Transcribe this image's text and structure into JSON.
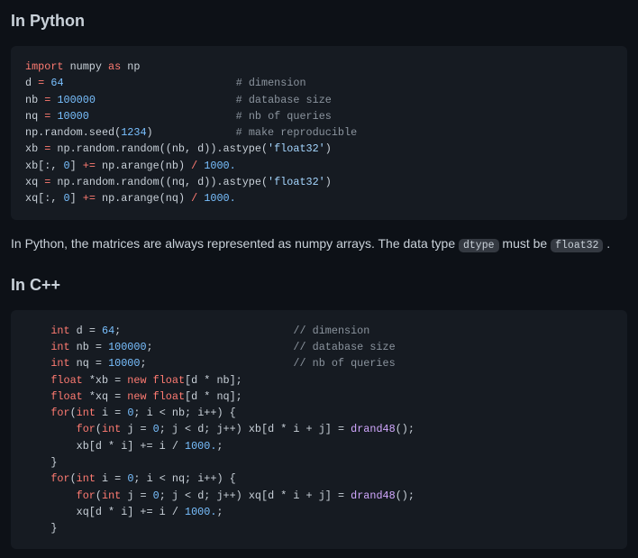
{
  "h_py": "In Python",
  "h_cpp": "In C++",
  "para": {
    "pre": "In Python, the matrices are always represented as numpy arrays. The data type ",
    "code1": "dtype",
    "mid": " must be ",
    "code2": "float32",
    "post": " ."
  },
  "py": {
    "l1_a": "import",
    "l1_b": " numpy ",
    "l1_c": "as",
    "l1_d": " np",
    "l2_a": "d ",
    "l2_b": "=",
    "l2_c": " ",
    "l2_d": "64",
    "l2_e": "                           ",
    "l2_f": "# dimension",
    "l3_a": "nb ",
    "l3_b": "=",
    "l3_c": " ",
    "l3_d": "100000",
    "l3_e": "                      ",
    "l3_f": "# database size",
    "l4_a": "nq ",
    "l4_b": "=",
    "l4_c": " ",
    "l4_d": "10000",
    "l4_e": "                       ",
    "l4_f": "# nb of queries",
    "l5_a": "np.random.seed(",
    "l5_b": "1234",
    "l5_c": ")             ",
    "l5_d": "# make reproducible",
    "l6_a": "xb ",
    "l6_b": "=",
    "l6_c": " np.random.random((nb, d)).astype(",
    "l6_d": "'float32'",
    "l6_e": ")",
    "l7_a": "xb[:, ",
    "l7_b": "0",
    "l7_c": "] ",
    "l7_d": "+=",
    "l7_e": " np.arange(nb) ",
    "l7_f": "/",
    "l7_g": " ",
    "l7_h": "1000.",
    "l8_a": "xq ",
    "l8_b": "=",
    "l8_c": " np.random.random((nq, d)).astype(",
    "l8_d": "'float32'",
    "l8_e": ")",
    "l9_a": "xq[:, ",
    "l9_b": "0",
    "l9_c": "] ",
    "l9_d": "+=",
    "l9_e": " np.arange(nq) ",
    "l9_f": "/",
    "l9_g": " ",
    "l9_h": "1000."
  },
  "cpp": {
    "pad": "    ",
    "pad2": "        ",
    "l1_a": "int",
    "l1_b": " d = ",
    "l1_c": "64",
    "l1_d": ";                           ",
    "l1_e": "// dimension",
    "l2_a": "int",
    "l2_b": " nb = ",
    "l2_c": "100000",
    "l2_d": ";                      ",
    "l2_e": "// database size",
    "l3_a": "int",
    "l3_b": " nq = ",
    "l3_c": "10000",
    "l3_d": ";                       ",
    "l3_e": "// nb of queries",
    "l4_a": "float",
    "l4_b": " *xb = ",
    "l4_c": "new",
    "l4_d": " ",
    "l4_e": "float",
    "l4_f": "[d * nb];",
    "l5_a": "float",
    "l5_b": " *xq = ",
    "l5_c": "new",
    "l5_d": " ",
    "l5_e": "float",
    "l5_f": "[d * nq];",
    "l6_a": "for",
    "l6_b": "(",
    "l6_c": "int",
    "l6_d": " i = ",
    "l6_e": "0",
    "l6_f": "; i < nb; i++) {",
    "l7_a": "for",
    "l7_b": "(",
    "l7_c": "int",
    "l7_d": " j = ",
    "l7_e": "0",
    "l7_f": "; j < d; j++) xb[d * i + j] = ",
    "l7_g": "drand48",
    "l7_h": "();",
    "l8_a": "xb[d * i] += i / ",
    "l8_b": "1000.",
    "l8_c": ";",
    "l9": "}",
    "l10_a": "for",
    "l10_b": "(",
    "l10_c": "int",
    "l10_d": " i = ",
    "l10_e": "0",
    "l10_f": "; i < nq; i++) {",
    "l11_a": "for",
    "l11_b": "(",
    "l11_c": "int",
    "l11_d": " j = ",
    "l11_e": "0",
    "l11_f": "; j < d; j++) xq[d * i + j] = ",
    "l11_g": "drand48",
    "l11_h": "();",
    "l12_a": "xq[d * i] += i / ",
    "l12_b": "1000.",
    "l12_c": ";",
    "l13": "}"
  }
}
